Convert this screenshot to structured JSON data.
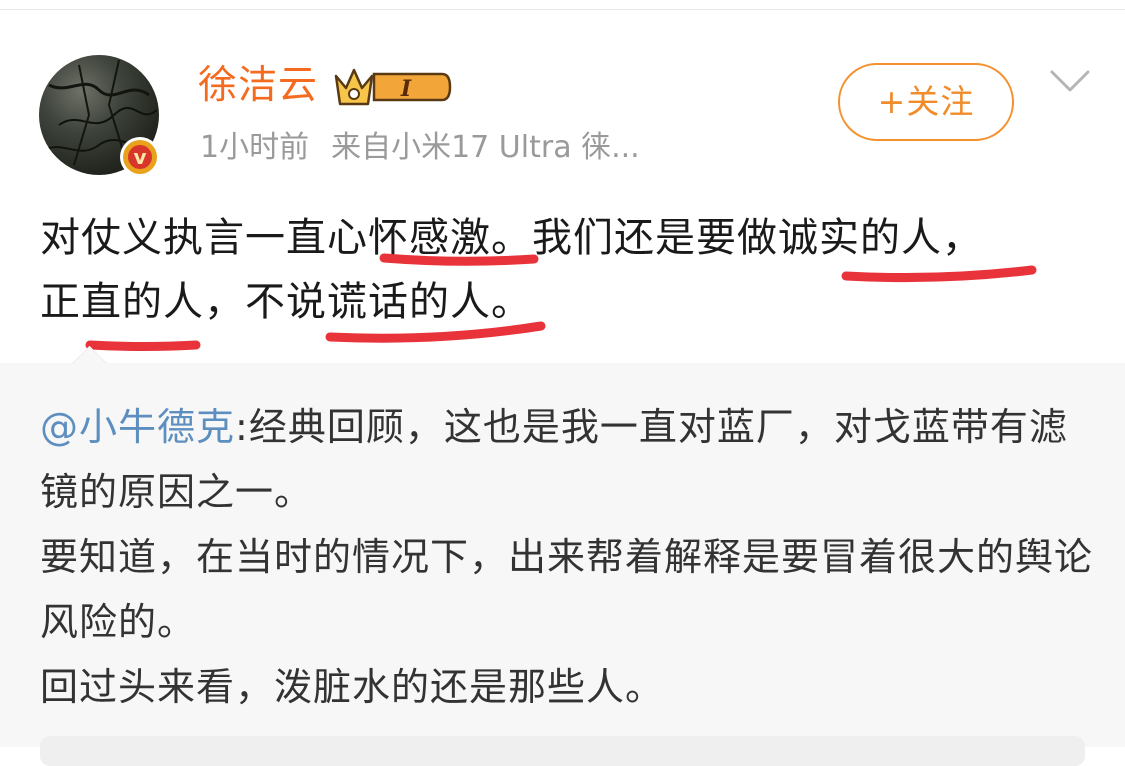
{
  "post": {
    "username": "徐洁云",
    "vip_level": "I",
    "time": "1小时前",
    "source": "来自小米17 Ultra 徕...",
    "follow_label": "+关注",
    "lines": [
      "对仗义执言一直心怀感激。我们还是要做诚实的人，",
      "正直的人，不说谎话的人。"
    ],
    "highlight_color": "#e8333a"
  },
  "repost": {
    "mention": "@小牛德克",
    "paragraphs": [
      ":经典回顾，这也是我一直对蓝厂，对戈蓝带有滤镜的原因之一。",
      "要知道，在当时的情况下，出来帮着解释是要冒着很大的舆论风险的。",
      "回过头来看，泼脏水的还是那些人。"
    ]
  },
  "colors": {
    "username": "#f46b1f",
    "follow": "#f08c2a",
    "mention": "#5c8fbf",
    "meta": "#9a9a9a",
    "repost_bg": "#f7f7f7"
  }
}
